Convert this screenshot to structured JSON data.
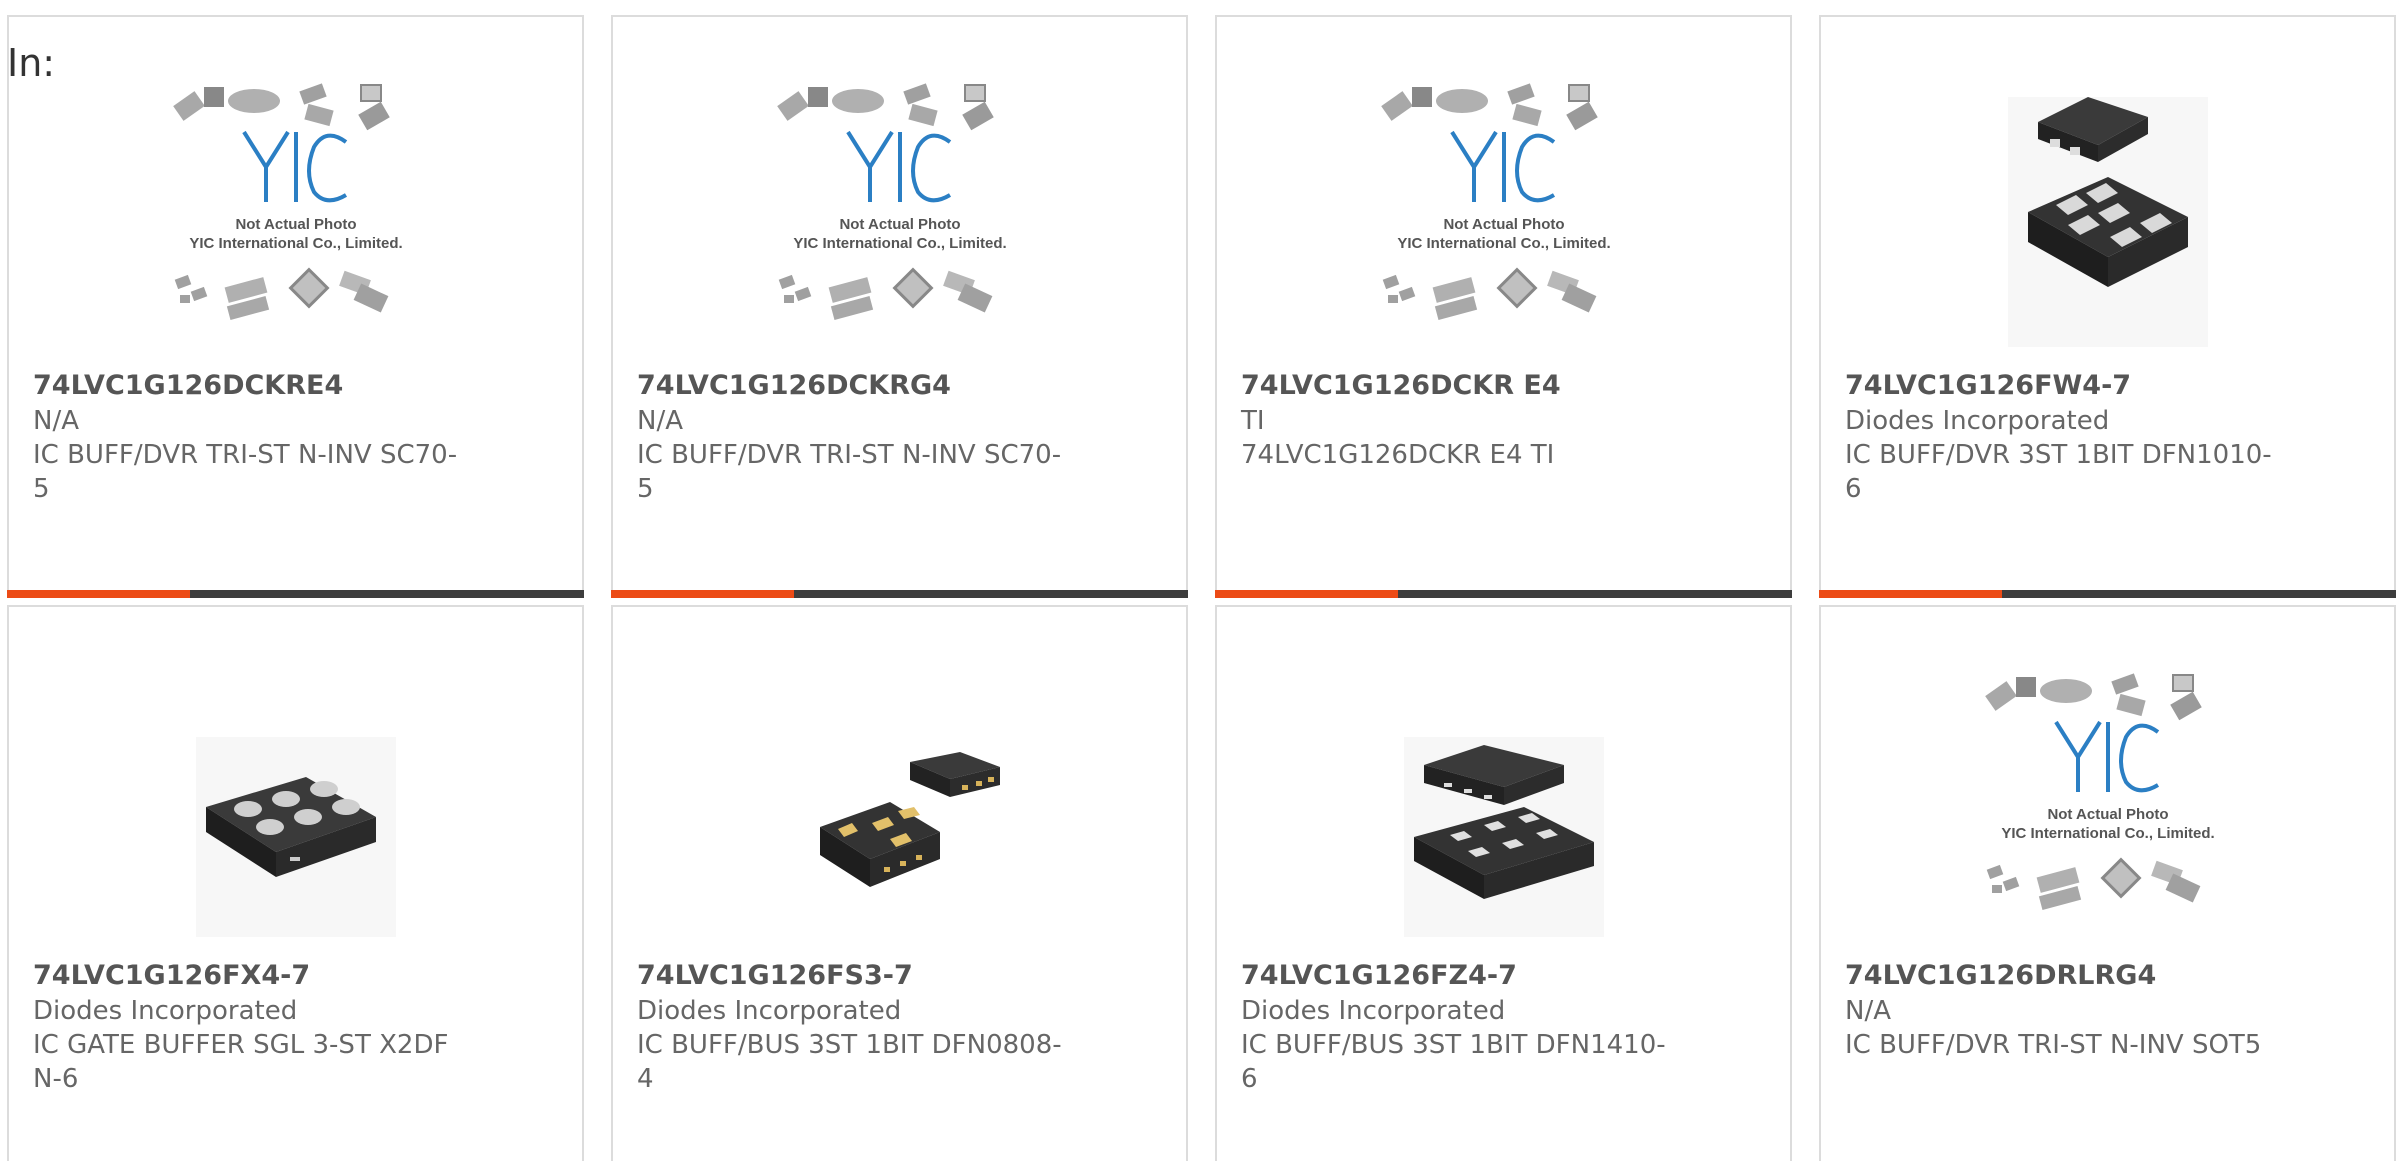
{
  "filter": {
    "label": "In:"
  },
  "colors": {
    "accent": "#ec4b16",
    "bar": "#3d3d3d",
    "border": "#dcdcdc"
  },
  "placeholder": {
    "line1": "Not Actual Photo",
    "line2": "YIC International Co., Limited."
  },
  "products": [
    {
      "part": "74LVC1G126DCKRE4",
      "maker": "N/A",
      "desc": "IC BUFF/DVR TRI-ST N-INV SC70-5",
      "image": "placeholder-logo"
    },
    {
      "part": "74LVC1G126DCKRG4",
      "maker": "N/A",
      "desc": "IC BUFF/DVR TRI-ST N-INV SC70-5",
      "image": "placeholder-logo"
    },
    {
      "part": "74LVC1G126DCKR E4",
      "maker": "TI",
      "desc": "74LVC1G126DCKR E4 TI",
      "image": "placeholder-logo"
    },
    {
      "part": "74LVC1G126FW4-7",
      "maker": "Diodes Incorporated",
      "desc": "IC BUFF/DVR 3ST 1BIT DFN1010-6",
      "image": "chip-dfn1010"
    },
    {
      "part": "74LVC1G126FX4-7",
      "maker": "Diodes Incorporated",
      "desc": "IC GATE BUFFER SGL 3-ST X2DFN-6",
      "image": "chip-x2dfn"
    },
    {
      "part": "74LVC1G126FS3-7",
      "maker": "Diodes Incorporated",
      "desc": "IC BUFF/BUS 3ST 1BIT DFN0808-4",
      "image": "chip-dfn0808"
    },
    {
      "part": "74LVC1G126FZ4-7",
      "maker": "Diodes Incorporated",
      "desc": "IC BUFF/BUS 3ST 1BIT DFN1410-6",
      "image": "chip-dfn1410"
    },
    {
      "part": "74LVC1G126DRLRG4",
      "maker": "N/A",
      "desc": "IC BUFF/DVR TRI-ST N-INV SOT5",
      "image": "placeholder-logo"
    }
  ]
}
